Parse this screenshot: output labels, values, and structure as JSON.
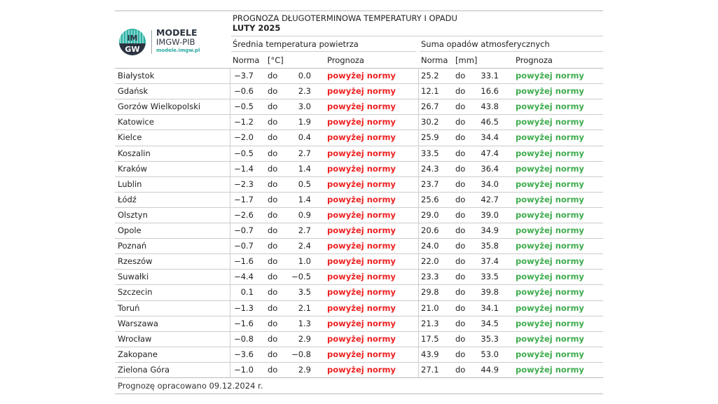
{
  "logo": {
    "line1": "MODELE",
    "line2": "IMGW-PIB",
    "line3": "modele.imgw.pl",
    "mark_text": "IM GW",
    "colors": {
      "teal": "#2bb3a5",
      "dark": "#2b3340"
    }
  },
  "title": {
    "line1": "PROGNOZA DŁUGOTERMINOWA TEMPERATURY I OPADU",
    "line2": "LUTY 2025"
  },
  "headers": {
    "temp_group": "Średnia temperatura powietrza",
    "precip_group": "Suma opadów atmosferycznych",
    "temp_norma": "Norma",
    "temp_unit": "[°C]",
    "temp_prognoza": "Prognoza",
    "precip_norma": "Norma",
    "precip_unit": "[mm]",
    "precip_prognoza": "Prognoza"
  },
  "colors": {
    "above_temp": "#ee2222",
    "above_precip": "#3fac4e"
  },
  "rows": [
    {
      "city": "Białystok",
      "t_min": "−3.7",
      "t_do": "do",
      "t_max": "0.0",
      "t_prog": "powyżej normy",
      "p_min": "25.2",
      "p_do": "do",
      "p_max": "33.1",
      "p_prog": "powyżej normy"
    },
    {
      "city": "Gdańsk",
      "t_min": "−0.6",
      "t_do": "do",
      "t_max": "2.3",
      "t_prog": "powyżej normy",
      "p_min": "12.1",
      "p_do": "do",
      "p_max": "16.6",
      "p_prog": "powyżej normy"
    },
    {
      "city": "Gorzów Wielkopolski",
      "t_min": "−0.5",
      "t_do": "do",
      "t_max": "3.0",
      "t_prog": "powyżej normy",
      "p_min": "26.7",
      "p_do": "do",
      "p_max": "43.8",
      "p_prog": "powyżej normy"
    },
    {
      "city": "Katowice",
      "t_min": "−1.2",
      "t_do": "do",
      "t_max": "1.9",
      "t_prog": "powyżej normy",
      "p_min": "30.2",
      "p_do": "do",
      "p_max": "46.5",
      "p_prog": "powyżej normy"
    },
    {
      "city": "Kielce",
      "t_min": "−2.0",
      "t_do": "do",
      "t_max": "0.4",
      "t_prog": "powyżej normy",
      "p_min": "25.9",
      "p_do": "do",
      "p_max": "34.4",
      "p_prog": "powyżej normy"
    },
    {
      "city": "Koszalin",
      "t_min": "−0.5",
      "t_do": "do",
      "t_max": "2.7",
      "t_prog": "powyżej normy",
      "p_min": "33.5",
      "p_do": "do",
      "p_max": "47.4",
      "p_prog": "powyżej normy"
    },
    {
      "city": "Kraków",
      "t_min": "−1.4",
      "t_do": "do",
      "t_max": "1.4",
      "t_prog": "powyżej normy",
      "p_min": "24.3",
      "p_do": "do",
      "p_max": "36.4",
      "p_prog": "powyżej normy"
    },
    {
      "city": "Lublin",
      "t_min": "−2.3",
      "t_do": "do",
      "t_max": "0.5",
      "t_prog": "powyżej normy",
      "p_min": "23.7",
      "p_do": "do",
      "p_max": "34.0",
      "p_prog": "powyżej normy"
    },
    {
      "city": "Łódź",
      "t_min": "−1.7",
      "t_do": "do",
      "t_max": "1.4",
      "t_prog": "powyżej normy",
      "p_min": "25.6",
      "p_do": "do",
      "p_max": "42.7",
      "p_prog": "powyżej normy"
    },
    {
      "city": "Olsztyn",
      "t_min": "−2.6",
      "t_do": "do",
      "t_max": "0.9",
      "t_prog": "powyżej normy",
      "p_min": "29.0",
      "p_do": "do",
      "p_max": "39.0",
      "p_prog": "powyżej normy"
    },
    {
      "city": "Opole",
      "t_min": "−0.7",
      "t_do": "do",
      "t_max": "2.7",
      "t_prog": "powyżej normy",
      "p_min": "20.6",
      "p_do": "do",
      "p_max": "34.9",
      "p_prog": "powyżej normy"
    },
    {
      "city": "Poznań",
      "t_min": "−0.7",
      "t_do": "do",
      "t_max": "2.4",
      "t_prog": "powyżej normy",
      "p_min": "24.0",
      "p_do": "do",
      "p_max": "35.8",
      "p_prog": "powyżej normy"
    },
    {
      "city": "Rzeszów",
      "t_min": "−1.6",
      "t_do": "do",
      "t_max": "1.0",
      "t_prog": "powyżej normy",
      "p_min": "22.0",
      "p_do": "do",
      "p_max": "37.4",
      "p_prog": "powyżej normy"
    },
    {
      "city": "Suwałki",
      "t_min": "−4.4",
      "t_do": "do",
      "t_max": "−0.5",
      "t_prog": "powyżej normy",
      "p_min": "23.3",
      "p_do": "do",
      "p_max": "33.5",
      "p_prog": "powyżej normy"
    },
    {
      "city": "Szczecin",
      "t_min": "0.1",
      "t_do": "do",
      "t_max": "3.5",
      "t_prog": "powyżej normy",
      "p_min": "29.8",
      "p_do": "do",
      "p_max": "39.8",
      "p_prog": "powyżej normy"
    },
    {
      "city": "Toruń",
      "t_min": "−1.3",
      "t_do": "do",
      "t_max": "2.1",
      "t_prog": "powyżej normy",
      "p_min": "21.0",
      "p_do": "do",
      "p_max": "34.1",
      "p_prog": "powyżej normy"
    },
    {
      "city": "Warszawa",
      "t_min": "−1.6",
      "t_do": "do",
      "t_max": "1.3",
      "t_prog": "powyżej normy",
      "p_min": "21.3",
      "p_do": "do",
      "p_max": "34.5",
      "p_prog": "powyżej normy"
    },
    {
      "city": "Wrocław",
      "t_min": "−0.8",
      "t_do": "do",
      "t_max": "2.9",
      "t_prog": "powyżej normy",
      "p_min": "17.5",
      "p_do": "do",
      "p_max": "35.3",
      "p_prog": "powyżej normy"
    },
    {
      "city": "Zakopane",
      "t_min": "−3.6",
      "t_do": "do",
      "t_max": "−0.8",
      "t_prog": "powyżej normy",
      "p_min": "43.9",
      "p_do": "do",
      "p_max": "53.0",
      "p_prog": "powyżej normy"
    },
    {
      "city": "Zielona Góra",
      "t_min": "−1.0",
      "t_do": "do",
      "t_max": "2.9",
      "t_prog": "powyżej normy",
      "p_min": "27.1",
      "p_do": "do",
      "p_max": "44.9",
      "p_prog": "powyżej normy"
    }
  ],
  "footer": "Prognozę opracowano 09.12.2024 r."
}
